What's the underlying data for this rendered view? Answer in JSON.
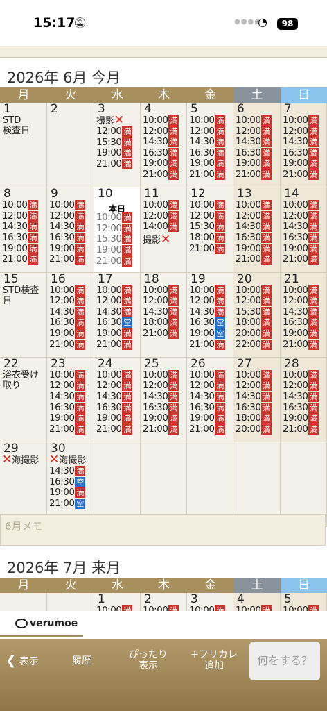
{
  "status": {
    "time": "15:17",
    "battery": "98"
  },
  "june": {
    "title": "2026年 6月 今月",
    "weekdays": [
      "月",
      "火",
      "水",
      "木",
      "金",
      "土",
      "日"
    ],
    "today_label": "本日",
    "memo_placeholder": "6月メモ",
    "days": [
      {
        "d": "1",
        "note": "STD\n検査日"
      },
      {
        "d": "2"
      },
      {
        "d": "3",
        "events": [
          {
            "x": true,
            "t": "撮影"
          }
        ],
        "slots": [
          [
            "12:00",
            "full"
          ],
          [
            "15:30",
            "full"
          ],
          [
            "19:00",
            "full"
          ],
          [
            "21:00",
            "full"
          ]
        ]
      },
      {
        "d": "4",
        "slots": [
          [
            "10:00",
            "full"
          ],
          [
            "12:00",
            "full"
          ],
          [
            "14:30",
            "full"
          ],
          [
            "16:30",
            "full"
          ],
          [
            "19:00",
            "full"
          ],
          [
            "21:00",
            "full"
          ]
        ]
      },
      {
        "d": "5",
        "slots": [
          [
            "10:00",
            "full"
          ],
          [
            "12:00",
            "full"
          ],
          [
            "14:30",
            "full"
          ],
          [
            "16:30",
            "full"
          ],
          [
            "19:00",
            "full"
          ],
          [
            "21:00",
            "full"
          ]
        ]
      },
      {
        "d": "6",
        "slots": [
          [
            "10:00",
            "full"
          ],
          [
            "12:00",
            "full"
          ],
          [
            "14:30",
            "full"
          ],
          [
            "16:30",
            "full"
          ],
          [
            "19:00",
            "full"
          ],
          [
            "21:00",
            "full"
          ]
        ]
      },
      {
        "d": "7",
        "slots": [
          [
            "10:00",
            "full"
          ],
          [
            "12:00",
            "full"
          ],
          [
            "14:30",
            "full"
          ],
          [
            "16:30",
            "full"
          ],
          [
            "19:00",
            "full"
          ],
          [
            "21:00",
            "full"
          ]
        ]
      },
      {
        "d": "8",
        "slots": [
          [
            "10:00",
            "full"
          ],
          [
            "12:00",
            "full"
          ],
          [
            "14:30",
            "full"
          ],
          [
            "16:30",
            "full"
          ],
          [
            "19:00",
            "full"
          ],
          [
            "21:00",
            "full"
          ]
        ]
      },
      {
        "d": "9",
        "slots": [
          [
            "10:00",
            "full"
          ],
          [
            "12:00",
            "full"
          ],
          [
            "14:30",
            "full"
          ],
          [
            "16:30",
            "full"
          ],
          [
            "19:00",
            "full"
          ],
          [
            "21:00",
            "full"
          ]
        ]
      },
      {
        "d": "10",
        "today": true,
        "slots": [
          [
            "10:00",
            "full"
          ],
          [
            "12:00",
            "full"
          ],
          [
            "15:30",
            "full"
          ],
          [
            "19:00",
            "full"
          ],
          [
            "21:00",
            "full"
          ]
        ]
      },
      {
        "d": "11",
        "slots": [
          [
            "10:00",
            "full"
          ],
          [
            "12:00",
            "full"
          ],
          [
            "14:00",
            "full"
          ]
        ],
        "events_after": [
          {
            "x": true,
            "t": "撮影",
            "xpos": "after"
          }
        ]
      },
      {
        "d": "12",
        "slots": [
          [
            "10:00",
            "full"
          ],
          [
            "12:00",
            "full"
          ],
          [
            "15:30",
            "full"
          ],
          [
            "18:00",
            "full"
          ],
          [
            "21:00",
            "full"
          ]
        ]
      },
      {
        "d": "13",
        "slots": [
          [
            "10:00",
            "full"
          ],
          [
            "12:00",
            "full"
          ],
          [
            "14:30",
            "full"
          ],
          [
            "16:30",
            "full"
          ],
          [
            "19:00",
            "full"
          ],
          [
            "21:00",
            "full"
          ]
        ]
      },
      {
        "d": "14",
        "slots": [
          [
            "10:00",
            "full"
          ],
          [
            "12:00",
            "full"
          ],
          [
            "14:30",
            "full"
          ],
          [
            "16:30",
            "full"
          ],
          [
            "19:00",
            "full"
          ],
          [
            "21:00",
            "full"
          ]
        ]
      },
      {
        "d": "15",
        "note": "STD検査\n日"
      },
      {
        "d": "16",
        "slots": [
          [
            "10:00",
            "full"
          ],
          [
            "12:00",
            "full"
          ],
          [
            "14:30",
            "full"
          ],
          [
            "16:30",
            "full"
          ],
          [
            "19:00",
            "full"
          ],
          [
            "21:00",
            "full"
          ]
        ]
      },
      {
        "d": "17",
        "slots": [
          [
            "10:00",
            "full"
          ],
          [
            "12:00",
            "full"
          ],
          [
            "14:30",
            "full"
          ],
          [
            "16:30",
            "empty"
          ],
          [
            "19:00",
            "full"
          ],
          [
            "21:00",
            "full"
          ]
        ]
      },
      {
        "d": "18",
        "slots": [
          [
            "10:00",
            "full"
          ],
          [
            "12:00",
            "full"
          ],
          [
            "14:30",
            "full"
          ],
          [
            "18:00",
            "full"
          ],
          [
            "21:00",
            "full"
          ]
        ]
      },
      {
        "d": "19",
        "slots": [
          [
            "10:00",
            "full"
          ],
          [
            "12:00",
            "full"
          ],
          [
            "14:30",
            "full"
          ],
          [
            "16:30",
            "empty"
          ],
          [
            "19:00",
            "empty"
          ],
          [
            "21:00",
            "full"
          ]
        ]
      },
      {
        "d": "20",
        "slots": [
          [
            "10:00",
            "full"
          ],
          [
            "12:00",
            "full"
          ],
          [
            "15:30",
            "full"
          ],
          [
            "18:00",
            "full"
          ],
          [
            "20:00",
            "full"
          ],
          [
            "22:00",
            "full"
          ]
        ]
      },
      {
        "d": "21",
        "slots": [
          [
            "10:00",
            "full"
          ],
          [
            "12:00",
            "full"
          ],
          [
            "14:30",
            "full"
          ],
          [
            "16:30",
            "full"
          ],
          [
            "19:00",
            "full"
          ],
          [
            "21:00",
            "full"
          ]
        ]
      },
      {
        "d": "22",
        "note": "浴衣受け\n取り"
      },
      {
        "d": "23",
        "slots": [
          [
            "10:00",
            "full"
          ],
          [
            "12:00",
            "full"
          ],
          [
            "14:30",
            "full"
          ],
          [
            "16:30",
            "full"
          ],
          [
            "19:00",
            "full"
          ],
          [
            "21:00",
            "full"
          ]
        ]
      },
      {
        "d": "24",
        "slots": [
          [
            "10:00",
            "full"
          ],
          [
            "12:00",
            "full"
          ],
          [
            "14:30",
            "full"
          ],
          [
            "16:30",
            "full"
          ],
          [
            "19:00",
            "full"
          ],
          [
            "21:00",
            "full"
          ]
        ]
      },
      {
        "d": "25",
        "slots": [
          [
            "10:00",
            "full"
          ],
          [
            "12:00",
            "full"
          ],
          [
            "14:30",
            "full"
          ],
          [
            "16:30",
            "full"
          ],
          [
            "19:00",
            "full"
          ],
          [
            "21:00",
            "full"
          ]
        ]
      },
      {
        "d": "26",
        "slots": [
          [
            "10:00",
            "full"
          ],
          [
            "12:00",
            "full"
          ],
          [
            "14:30",
            "full"
          ],
          [
            "16:30",
            "full"
          ],
          [
            "19:00",
            "full"
          ],
          [
            "21:00",
            "full"
          ]
        ]
      },
      {
        "d": "27",
        "slots": [
          [
            "10:00",
            "full"
          ],
          [
            "12:00",
            "full"
          ],
          [
            "14:30",
            "full"
          ],
          [
            "16:30",
            "full"
          ],
          [
            "18:00",
            "full"
          ],
          [
            "20:00",
            "full"
          ]
        ]
      },
      {
        "d": "28",
        "slots": [
          [
            "10:00",
            "full"
          ],
          [
            "12:00",
            "full"
          ],
          [
            "14:30",
            "full"
          ],
          [
            "16:30",
            "full"
          ],
          [
            "19:00",
            "full"
          ],
          [
            "21:00",
            "full"
          ]
        ]
      },
      {
        "d": "29",
        "events": [
          {
            "x": true,
            "t": "海撮影"
          }
        ]
      },
      {
        "d": "30",
        "events": [
          {
            "x": true,
            "t": "海撮影"
          }
        ],
        "slots": [
          [
            "14:30",
            "full"
          ],
          [
            "16:30",
            "empty"
          ],
          [
            "19:00",
            "full"
          ],
          [
            "21:00",
            "empty"
          ]
        ]
      },
      {
        "d": ""
      },
      {
        "d": ""
      },
      {
        "d": ""
      },
      {
        "d": ""
      },
      {
        "d": ""
      }
    ]
  },
  "july": {
    "title": "2026年 7月 来月",
    "weekdays": [
      "月",
      "火",
      "水",
      "木",
      "金",
      "土",
      "日"
    ],
    "first_days": [
      "",
      "",
      "1",
      "2",
      "3",
      "4",
      "5"
    ],
    "first_slot": "10:00"
  },
  "badges": {
    "full": "満",
    "empty": "空"
  },
  "brand": "verumoe",
  "bottom": {
    "back": "表示",
    "history": "履歴",
    "fit": "ぴったり\n表示",
    "add": "+フリカレ\n追加",
    "ask": "何をする？"
  }
}
